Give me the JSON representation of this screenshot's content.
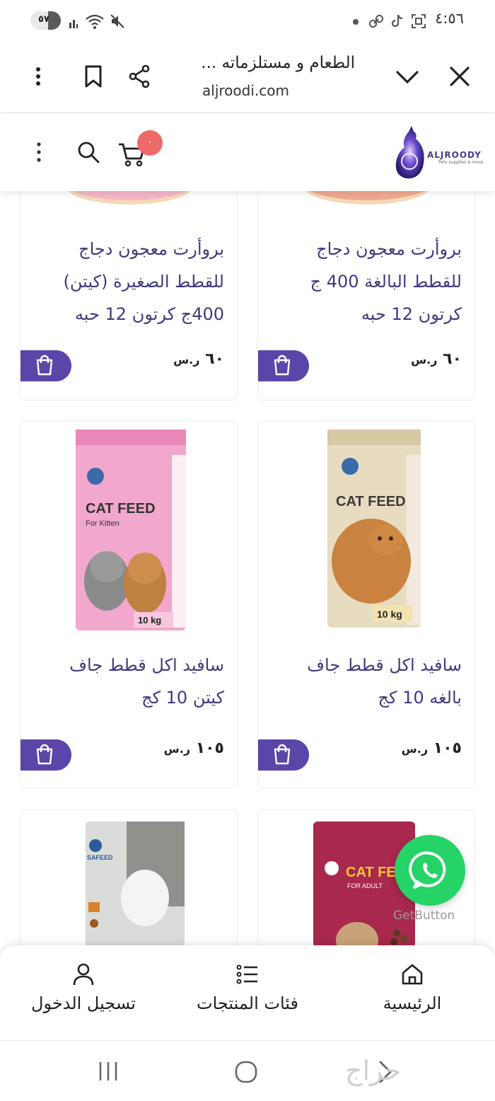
{
  "status_bar": {
    "time": "٤:٥٦",
    "battery_label": "٥٧",
    "battery_level": 0.57,
    "icons": [
      "signal-icon",
      "wifi-icon",
      "mute-icon",
      "dot-icon",
      "link-icon",
      "tiktok-icon",
      "screenshot-icon"
    ]
  },
  "browser": {
    "page_title": "الطعام و مستلزماته ...",
    "domain": "aljroodi.com",
    "icons": [
      "close-icon",
      "chevron-down-icon",
      "share-icon",
      "bookmark-icon",
      "more-vertical-icon"
    ]
  },
  "site_header": {
    "logo_text": "ALJROODY",
    "logo_subtext": "Pets supplies & more",
    "cart_count": "٠",
    "icons": [
      "more-vertical-icon",
      "search-icon",
      "cart-icon",
      "logo-cat-icon"
    ]
  },
  "products": [
    {
      "title": "بروأرت معجون دجاج للقطط البالغة 400 ج كرتون 12 حبه",
      "price": "٦٠",
      "currency": "ر.س"
    },
    {
      "title": "بروأرت معجون دجاج للقطط الصغيرة (كيتن) 400ج كرتون 12 حبه",
      "price": "٦٠",
      "currency": "ر.س"
    },
    {
      "title": "سافيد اكل قطط جاف بالغه 10 كج",
      "price": "١٠٥",
      "currency": "ر.س",
      "image_label": "CAT FEED",
      "image_weight": "10 kg"
    },
    {
      "title": "سافيد اكل قطط جاف كيتن 10 كج",
      "price": "١٠٥",
      "currency": "ر.س",
      "image_label": "CAT FEED",
      "image_sub": "For Kitten",
      "image_weight": "10 kg"
    },
    {
      "image_label": "CAT FEED",
      "image_sub": "FOR ADULT"
    },
    {
      "image_label": "SAFEED"
    }
  ],
  "whatsapp": {
    "provider": "GetButton"
  },
  "bottom_nav": {
    "items": [
      {
        "label": "الرئيسية",
        "icon": "home-icon"
      },
      {
        "label": "فئات المنتجات",
        "icon": "list-icon"
      },
      {
        "label": "تسجيل الدخول",
        "icon": "user-icon"
      }
    ]
  },
  "system_nav": {
    "watermark": "حراج",
    "icons": [
      "back-icon",
      "home-circle-icon",
      "recents-icon"
    ]
  },
  "colors": {
    "accent": "#5b45a8",
    "title": "#3f3a7e",
    "badge": "#f06a6a",
    "whatsapp": "#25d366"
  }
}
